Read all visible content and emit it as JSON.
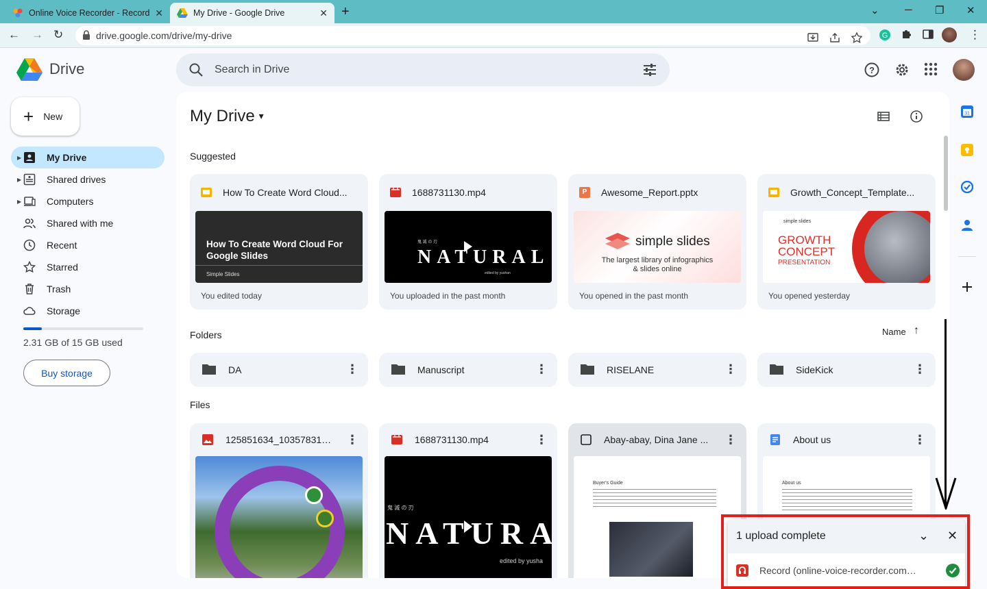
{
  "browser": {
    "tabs": [
      {
        "title": "Online Voice Recorder - Record V",
        "close": "✕"
      },
      {
        "title": "My Drive - Google Drive",
        "close": "✕"
      }
    ],
    "new_tab": "+",
    "url": "drive.google.com/drive/my-drive",
    "window_controls": {
      "minimize": "─",
      "restore": "❐",
      "close": "✕",
      "tab_search": "⌄"
    },
    "nav": {
      "back": "←",
      "forward": "→",
      "reload": "↻"
    }
  },
  "app": {
    "name": "Drive",
    "search_placeholder": "Search in Drive",
    "accent": "#0b57d0"
  },
  "sidebar": {
    "new_label": "New",
    "new_plus": "+",
    "items": [
      {
        "label": "My Drive",
        "icon": "my-drive-icon",
        "active": true,
        "expandable": true
      },
      {
        "label": "Shared drives",
        "icon": "shared-drives-icon",
        "expandable": true
      },
      {
        "label": "Computers",
        "icon": "computers-icon",
        "expandable": true
      },
      {
        "label": "Shared with me",
        "icon": "people-icon"
      },
      {
        "label": "Recent",
        "icon": "clock-icon"
      },
      {
        "label": "Starred",
        "icon": "star-icon"
      },
      {
        "label": "Trash",
        "icon": "trash-icon"
      },
      {
        "label": "Storage",
        "icon": "cloud-icon"
      }
    ],
    "storage_text": "2.31 GB of 15 GB used",
    "storage_fraction": 0.154,
    "buy_storage": "Buy storage"
  },
  "main": {
    "title": "My Drive",
    "title_caret": "▾",
    "suggested_label": "Suggested",
    "suggested": [
      {
        "name": "How To Create Word Cloud...",
        "type": "slides",
        "footer": "You edited today",
        "thumb_title": "How To Create Word Cloud For Google Slides",
        "thumb_sub": "Simple Slides"
      },
      {
        "name": "1688731130.mp4",
        "type": "video",
        "footer": "You uploaded in the past month",
        "thumb_title": "NATURAL",
        "thumb_sub": "edited by yushan",
        "thumb_kanji": "鬼 滅 の 刃"
      },
      {
        "name": "Awesome_Report.pptx",
        "type": "pptx",
        "footer": "You opened in the past month",
        "thumb_title": "simple slides",
        "thumb_sub": "The largest library of infographics & slides online",
        "badge": "P"
      },
      {
        "name": "Growth_Concept_Template...",
        "type": "slides",
        "footer": "You opened yesterday",
        "thumb_title": "GROWTH CONCEPT",
        "thumb_sub": "PRESENTATION",
        "thumb_brand": "simple slides"
      }
    ],
    "folders_label": "Folders",
    "sort_label": "Name",
    "sort_arrow": "↑",
    "folders": [
      "DA",
      "Manuscript",
      "RISELANE",
      "SideKick"
    ],
    "kebab": "⋮",
    "files_label": "Files",
    "files": [
      {
        "name": "125851634_1035783186...",
        "type": "image"
      },
      {
        "name": "1688731130.mp4",
        "type": "video",
        "thumb_title": "NATURAL",
        "thumb_kanji": "鬼 滅 の 刃",
        "thumb_sub": "edited by yusha"
      },
      {
        "name": "Abay-abay, Dina Jane ...",
        "type": "checkbox",
        "doc_title": "Buyer's Guide"
      },
      {
        "name": "About us",
        "type": "doc",
        "doc_title": "About us"
      }
    ]
  },
  "upload": {
    "title": "1 upload complete",
    "collapse": "⌄",
    "close": "✕",
    "item": "Record (online-voice-recorder.com).m...",
    "status": "complete"
  },
  "right_panel": [
    "calendar-icon",
    "keep-icon",
    "tasks-icon",
    "contacts-icon",
    "add-icon"
  ],
  "colors": {
    "tab_bar": "#5ebcc4",
    "selected_nav": "#c2e7ff",
    "card_bg": "#f0f4f9",
    "annotation_red": "#e0201b"
  }
}
